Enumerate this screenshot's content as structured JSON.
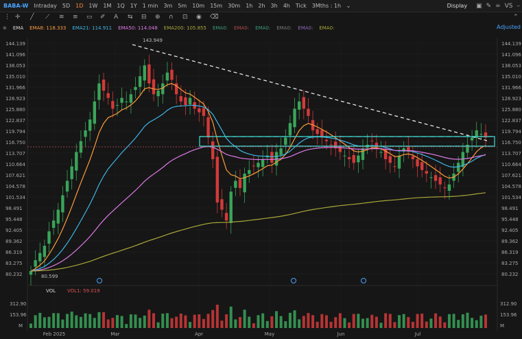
{
  "toolbar": {
    "symbol": "BABA-W",
    "timeframes": [
      "Intraday",
      "5D",
      "1D",
      "1W",
      "1M",
      "1Q",
      "1Y",
      "1 min",
      "3m",
      "5m",
      "10m",
      "15m",
      "30m",
      "1h",
      "2h",
      "3h",
      "4h",
      "Tick",
      "3Mths : 1h"
    ],
    "active_timeframe": "1D",
    "display_label": "Display",
    "compare_label": "VS"
  },
  "legend": {
    "ema_label": "EMA",
    "items": [
      {
        "text": "EMA8: 118.333",
        "color": "#ff9d3c"
      },
      {
        "text": "EMA21: 114.911",
        "color": "#3fb6e8"
      },
      {
        "text": "EMA50: 114.048",
        "color": "#e07ae8"
      },
      {
        "text": "EMA200: 105.855",
        "color": "#a8a83a"
      },
      {
        "text": "EMA0:",
        "color": "#3c9c7a"
      },
      {
        "text": "EMA0:",
        "color": "#b44b4b"
      },
      {
        "text": "EMA0:",
        "color": "#3c9c7a"
      },
      {
        "text": "EMA0:",
        "color": "#7a7a7a"
      },
      {
        "text": "EMA0:",
        "color": "#8a6ab8"
      },
      {
        "text": "EMA0:",
        "color": "#a8a83a"
      }
    ],
    "adjusted_label": "Adjusted"
  },
  "price_axis": [
    "144.139",
    "141.096",
    "138.053",
    "135.010",
    "131.966",
    "128.923",
    "125.880",
    "122.837",
    "119.794",
    "116.750",
    "113.707",
    "110.664",
    "107.621",
    "104.578",
    "101.534",
    "98.491",
    "95.448",
    "92.405",
    "89.362",
    "86.319",
    "83.275",
    "80.232"
  ],
  "annotations": {
    "high_label": "143.949",
    "low_label": "80.599"
  },
  "date_axis": [
    "Feb 2025",
    "Mar",
    "Apr",
    "May",
    "Jun",
    "Jul"
  ],
  "volume": {
    "label": "VOL",
    "vol_text": "VOL1: 59.019",
    "axis": [
      "312.90",
      "153.96",
      "M"
    ]
  },
  "colors": {
    "up": "#3aa45a",
    "down": "#d33a3a",
    "trend": "#e6e6e6",
    "box": "#3fd0c8",
    "dotted_price": "#c05060"
  },
  "chart_data": {
    "type": "candlestick",
    "ylim": [
      80.232,
      144.139
    ],
    "x": [
      "Feb 2025",
      "Mar",
      "Apr",
      "May",
      "Jun",
      "Jul"
    ],
    "series": [
      {
        "name": "EMA8",
        "value": 118.333
      },
      {
        "name": "EMA21",
        "value": 114.911
      },
      {
        "name": "EMA50",
        "value": 114.048
      },
      {
        "name": "EMA200",
        "value": 105.855
      }
    ],
    "closes": [
      81,
      84,
      86,
      88,
      92,
      95,
      98,
      102,
      106,
      110,
      114,
      117,
      120,
      123,
      128,
      133,
      131,
      129,
      126,
      127,
      129,
      128,
      130,
      132,
      135,
      138,
      133,
      130,
      131,
      133,
      136,
      134,
      130,
      128,
      127,
      129,
      126,
      125,
      124,
      118,
      112,
      100,
      98,
      95,
      103,
      106,
      104,
      108,
      109,
      110,
      111,
      112,
      113,
      111,
      114,
      115,
      118,
      122,
      126,
      128,
      126,
      124,
      120,
      119,
      118,
      117,
      116,
      115,
      114,
      113,
      112,
      111,
      113,
      115,
      116,
      117,
      115,
      114,
      112,
      111,
      110,
      113,
      115,
      114,
      112,
      110,
      109,
      108,
      107,
      106,
      105,
      104,
      105,
      108,
      111,
      114,
      116,
      118,
      120,
      119,
      118
    ]
  }
}
